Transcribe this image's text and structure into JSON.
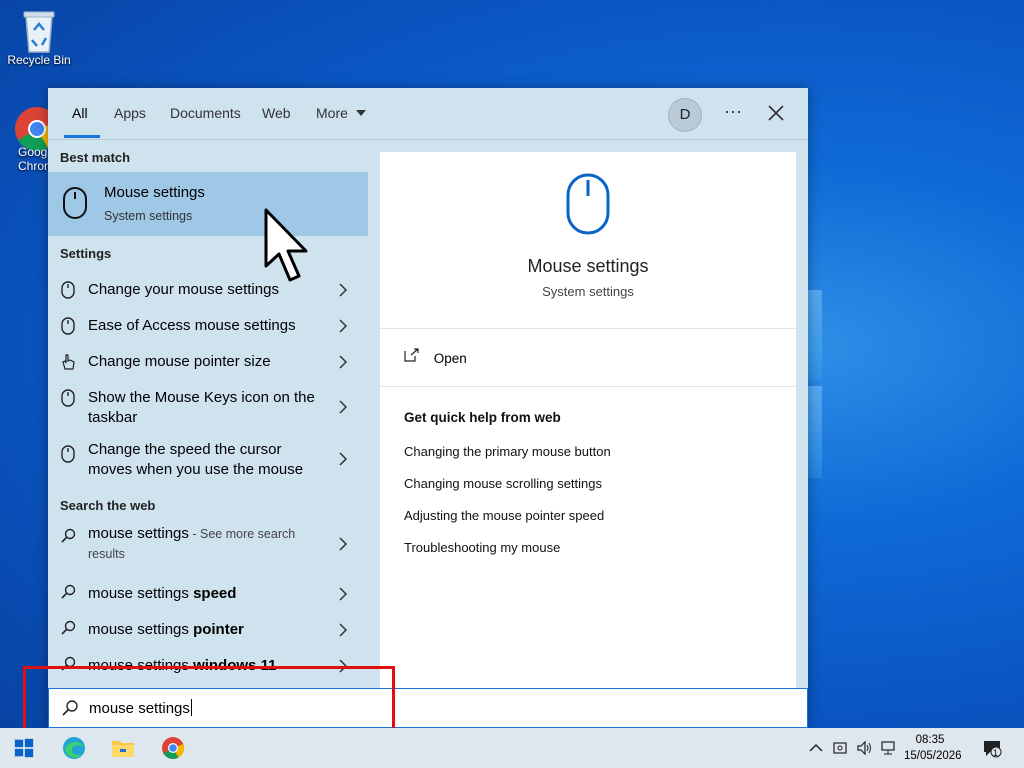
{
  "desktop": {
    "icons": [
      {
        "label": "Recycle Bin"
      },
      {
        "label": "Goog\nChron"
      }
    ]
  },
  "search": {
    "tabs": [
      "All",
      "Apps",
      "Documents",
      "Web",
      "More"
    ],
    "avatar_letter": "D",
    "more_dots": "···",
    "best_match_header": "Best match",
    "best_match": {
      "title": "Mouse settings",
      "subtitle": "System settings"
    },
    "settings_header": "Settings",
    "settings_items": [
      {
        "label": "Change your mouse settings"
      },
      {
        "label": "Ease of Access mouse settings"
      },
      {
        "label": "Change mouse pointer size"
      },
      {
        "label": "Show the Mouse Keys icon on the taskbar"
      },
      {
        "label": "Change the speed the cursor moves when you use the mouse"
      }
    ],
    "web_header": "Search the web",
    "web_items": [
      {
        "query": "mouse settings",
        "suffix": " - See more search results",
        "bold": ""
      },
      {
        "query": "mouse settings ",
        "suffix": "",
        "bold": "speed"
      },
      {
        "query": "mouse settings ",
        "suffix": "",
        "bold": "pointer"
      },
      {
        "query": "mouse settings ",
        "suffix": "",
        "bold": "windows 11"
      }
    ],
    "preview": {
      "title": "Mouse settings",
      "subtitle": "System settings",
      "open_label": "Open",
      "help_header": "Get quick help from web",
      "help_links": [
        "Changing the primary mouse button",
        "Changing mouse scrolling settings",
        "Adjusting the mouse pointer speed",
        "Troubleshooting my mouse"
      ]
    },
    "query_text": "mouse settings"
  },
  "taskbar": {
    "time": "08:35",
    "date": "15/05/2026",
    "notification_count": "1"
  },
  "colors": {
    "accent": "#1a73d9",
    "highlight_box": "#e01010",
    "selected_row": "#9fc7e6"
  }
}
